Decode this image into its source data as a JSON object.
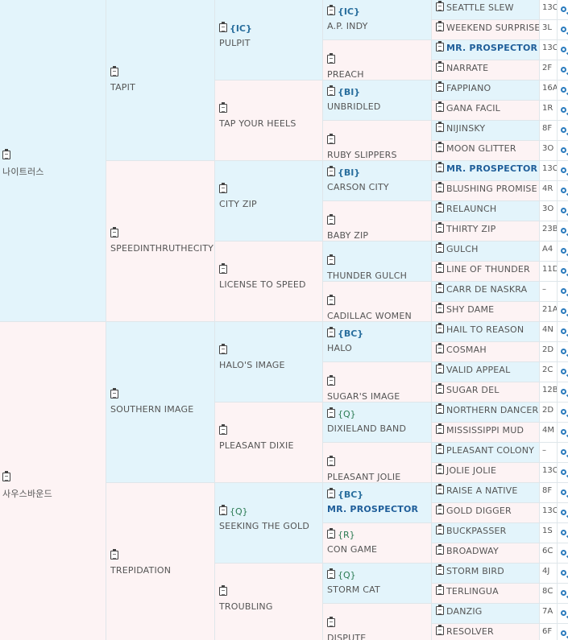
{
  "gen1": [
    {
      "name": "나이트러스"
    },
    {
      "name": "사우스바운드"
    }
  ],
  "gen2": [
    {
      "name": "TAPIT"
    },
    {
      "name": "SPEEDINTHRUTHECITY"
    },
    {
      "name": "SOUTHERN IMAGE"
    },
    {
      "name": "TREPIDATION"
    }
  ],
  "gen3": [
    {
      "tag": "{IC}",
      "name": "PULPIT"
    },
    {
      "tag": "",
      "name": "TAP YOUR HEELS"
    },
    {
      "tag": "",
      "name": "CITY ZIP"
    },
    {
      "tag": "",
      "name": "LICENSE TO SPEED"
    },
    {
      "tag": "",
      "name": "HALO'S IMAGE"
    },
    {
      "tag": "",
      "name": "PLEASANT DIXIE"
    },
    {
      "tag": "{Q}",
      "name": "SEEKING THE GOLD"
    },
    {
      "tag": "",
      "name": "TROUBLING"
    }
  ],
  "gen4": [
    {
      "tag": "{IC}",
      "name": "A.P. INDY"
    },
    {
      "tag": "",
      "name": "PREACH"
    },
    {
      "tag": "{BI}",
      "name": "UNBRIDLED"
    },
    {
      "tag": "",
      "name": "RUBY SLIPPERS"
    },
    {
      "tag": "{BI}",
      "name": "CARSON CITY"
    },
    {
      "tag": "",
      "name": "BABY ZIP"
    },
    {
      "tag": "",
      "name": "THUNDER GULCH"
    },
    {
      "tag": "",
      "name": "CADILLAC WOMEN"
    },
    {
      "tag": "{BC}",
      "name": "HALO"
    },
    {
      "tag": "",
      "name": "SUGAR'S IMAGE"
    },
    {
      "tag": "{Q}",
      "name": "DIXIELAND BAND"
    },
    {
      "tag": "",
      "name": "PLEASANT JOLIE"
    },
    {
      "tag": "{BC}",
      "name": "MR. PROSPECTOR"
    },
    {
      "tag": "{R}",
      "name": "CON GAME"
    },
    {
      "tag": "{Q}",
      "name": "STORM CAT"
    },
    {
      "tag": "",
      "name": "DISPUTE"
    }
  ],
  "gen5": [
    {
      "name": "SEATTLE SLEW",
      "num": "13C"
    },
    {
      "name": "WEEKEND SURPRISE",
      "num": "3L"
    },
    {
      "name": "MR. PROSPECTOR",
      "num": "13C"
    },
    {
      "name": "NARRATE",
      "num": "2F"
    },
    {
      "name": "FAPPIANO",
      "num": "16A"
    },
    {
      "name": "GANA FACIL",
      "num": "1R"
    },
    {
      "name": "NIJINSKY",
      "num": "8F"
    },
    {
      "name": "MOON GLITTER",
      "num": "3O"
    },
    {
      "name": "MR. PROSPECTOR",
      "num": "13C"
    },
    {
      "name": "BLUSHING PROMISE",
      "num": "4R"
    },
    {
      "name": "RELAUNCH",
      "num": "3O"
    },
    {
      "name": "THIRTY ZIP",
      "num": "23B"
    },
    {
      "name": "GULCH",
      "num": "A4"
    },
    {
      "name": "LINE OF THUNDER",
      "num": "11D"
    },
    {
      "name": "CARR DE NASKRA",
      "num": "–"
    },
    {
      "name": "SHY DAME",
      "num": "21A"
    },
    {
      "name": "HAIL TO REASON",
      "num": "4N"
    },
    {
      "name": "COSMAH",
      "num": "2D"
    },
    {
      "name": "VALID APPEAL",
      "num": "2C"
    },
    {
      "name": "SUGAR DEL",
      "num": "12B"
    },
    {
      "name": "NORTHERN DANCER",
      "num": "2D"
    },
    {
      "name": "MISSISSIPPI MUD",
      "num": "4M"
    },
    {
      "name": "PLEASANT COLONY",
      "num": "–"
    },
    {
      "name": "JOLIE JOLIE",
      "num": "13C"
    },
    {
      "name": "RAISE A NATIVE",
      "num": "8F"
    },
    {
      "name": "GOLD DIGGER",
      "num": "13C"
    },
    {
      "name": "BUCKPASSER",
      "num": "1S"
    },
    {
      "name": "BROADWAY",
      "num": "6C"
    },
    {
      "name": "STORM BIRD",
      "num": "4J"
    },
    {
      "name": "TERLINGUA",
      "num": "8C"
    },
    {
      "name": "DANZIG",
      "num": "7A"
    },
    {
      "name": "RESOLVER",
      "num": "6F"
    }
  ],
  "colors": {
    "male_bg": "#e3f4fb",
    "female_bg": "#fdf3f4",
    "link": "#1f5e9a"
  }
}
